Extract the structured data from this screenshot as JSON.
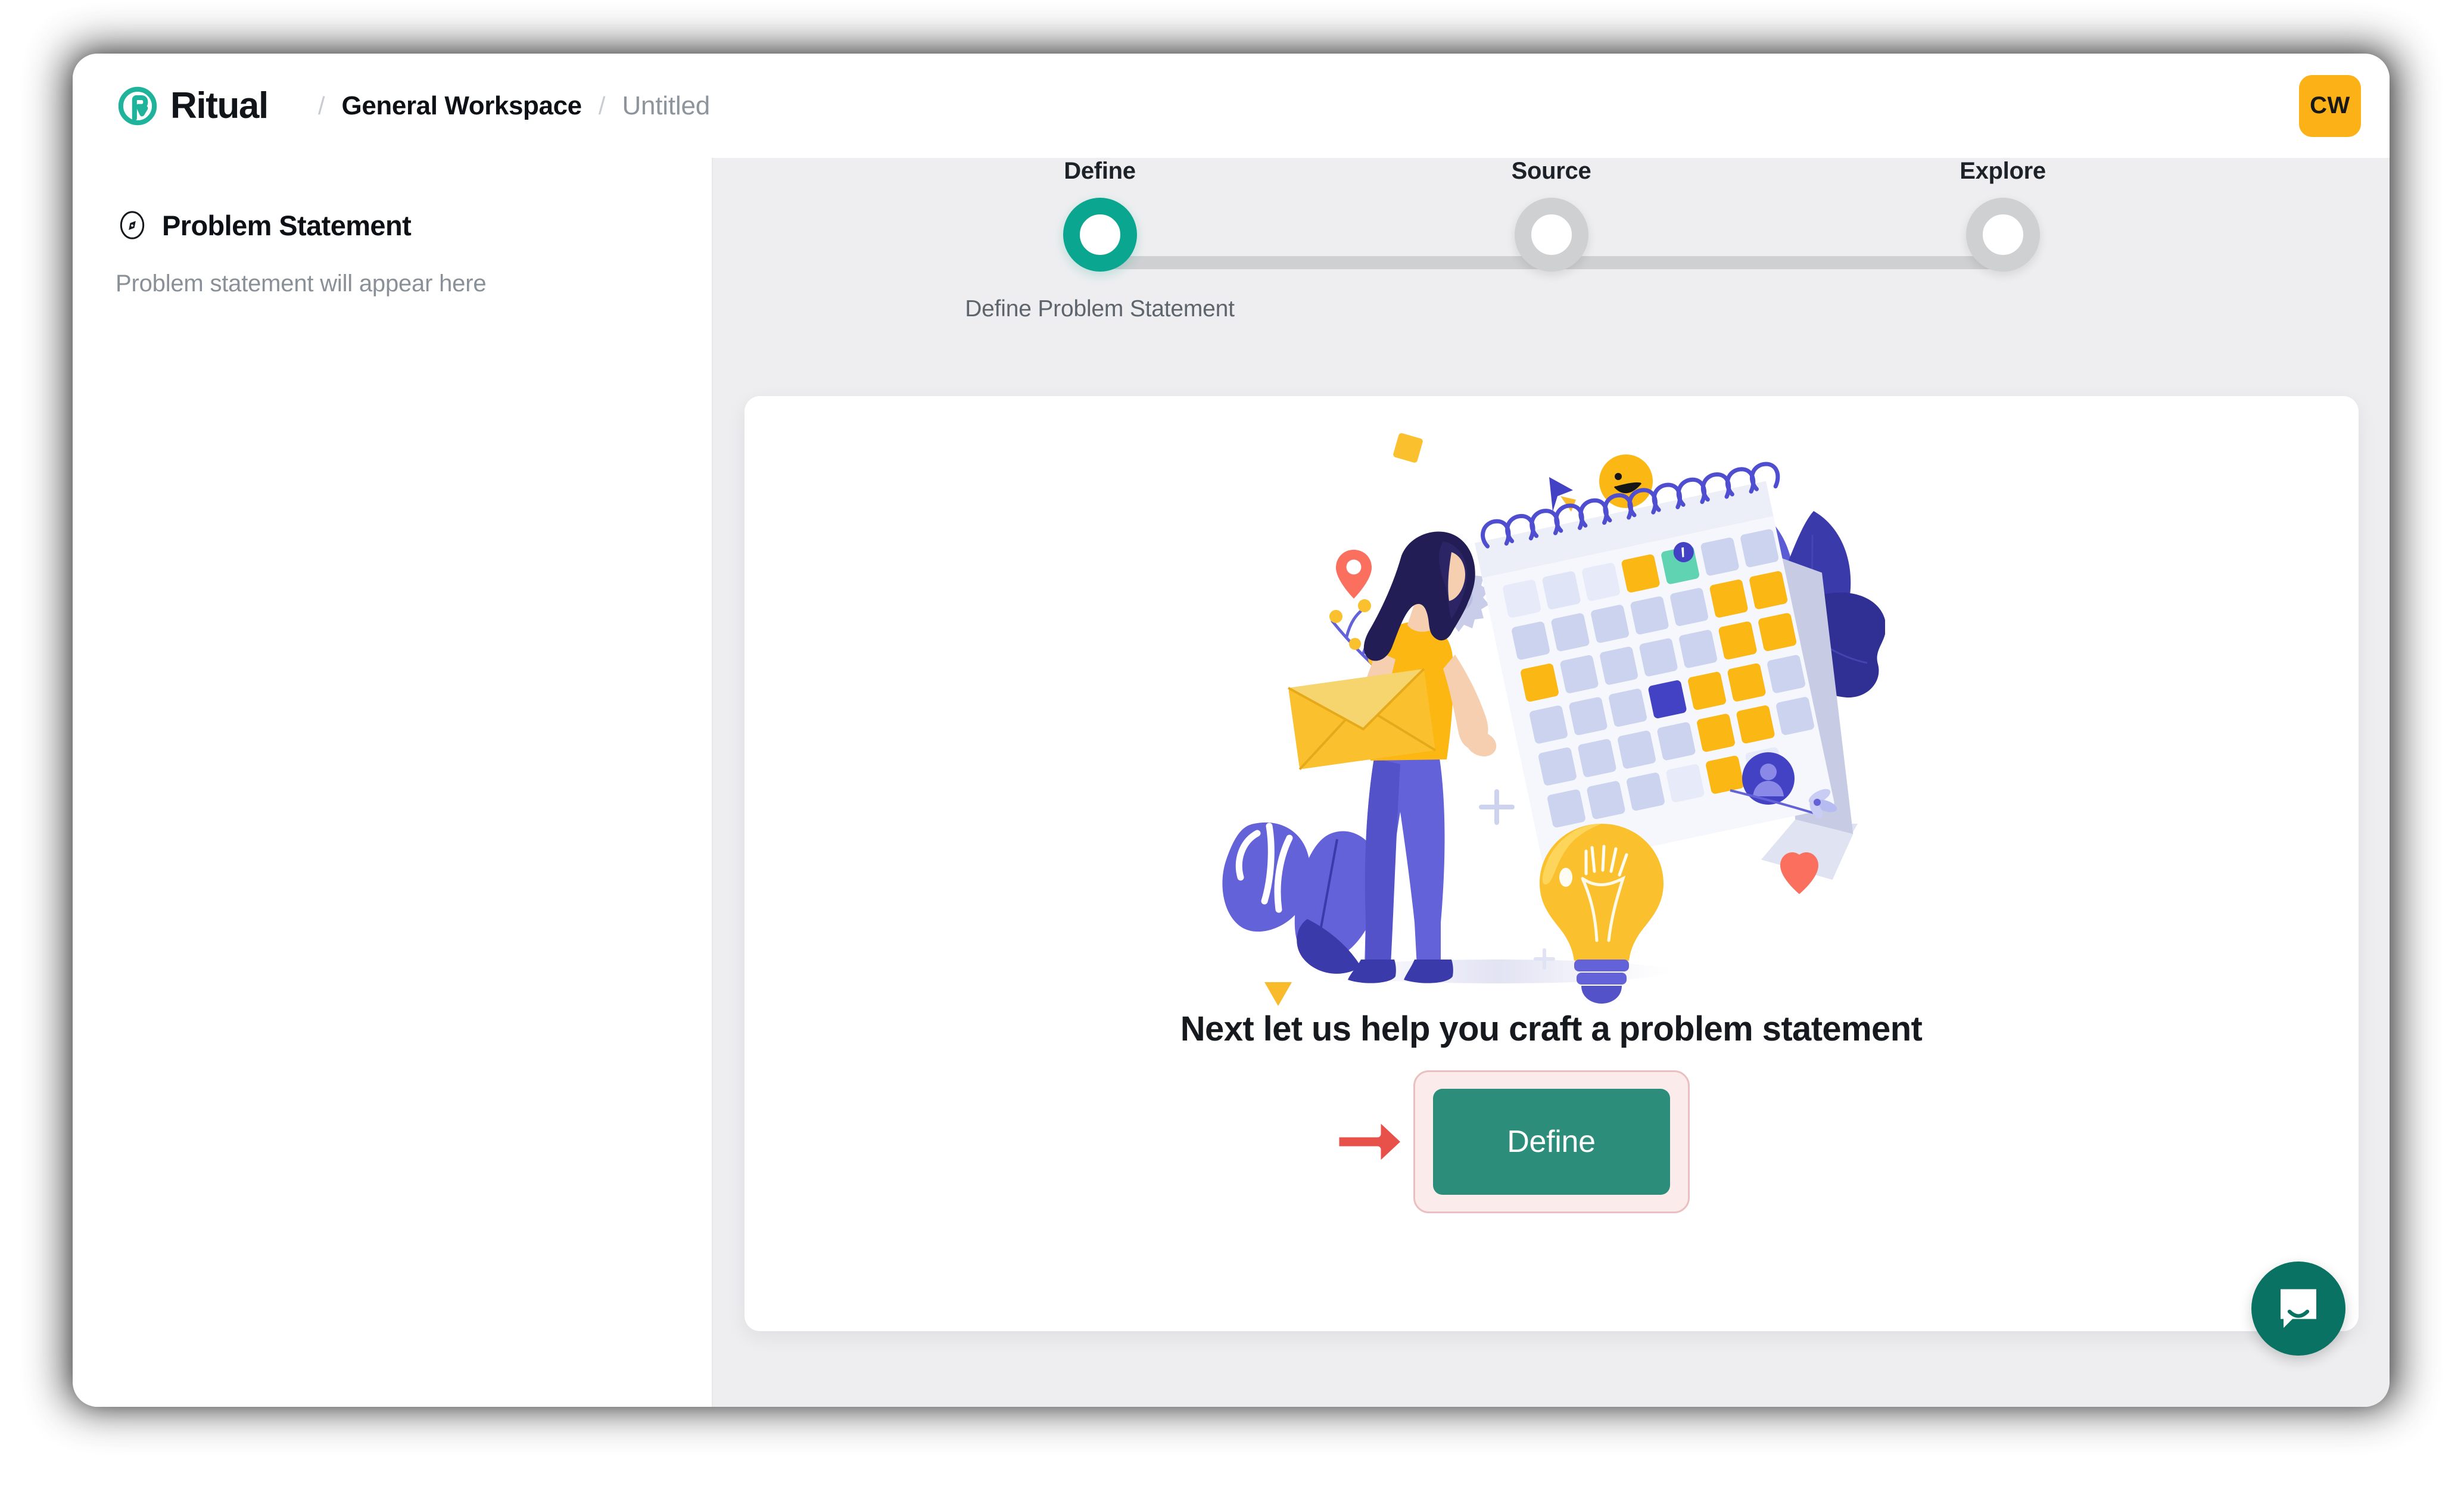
{
  "app": {
    "brand_name": "Ritual",
    "logo_icon": "ritual-logo-icon",
    "accent_teal": "#0aa68f",
    "button_teal": "#2d8d7b",
    "avatar_bg": "#fcb117"
  },
  "topbar": {
    "breadcrumb": {
      "separator": "/",
      "workspace": "General Workspace",
      "document": "Untitled"
    },
    "avatar_initials": "CW"
  },
  "sidebar": {
    "icon": "compass-icon",
    "title": "Problem Statement",
    "placeholder": "Problem statement will appear here"
  },
  "stepper": {
    "steps": [
      {
        "label": "Define",
        "state": "active"
      },
      {
        "label": "Source",
        "state": "pending"
      },
      {
        "label": "Explore",
        "state": "pending"
      }
    ],
    "active_caption": "Define Problem Statement"
  },
  "card": {
    "illustration": "woman-with-calendar-illustration",
    "headline": "Next let us help you craft a problem statement",
    "cta_label": "Define",
    "annotation": {
      "arrow_icon": "right-arrow-annotation-icon",
      "arrow_color": "#e8504a",
      "highlight_bg": "#fbeceb",
      "highlight_border": "#eabfbf"
    }
  },
  "launcher": {
    "icon": "intercom-chat-icon",
    "color": "#0a7263"
  }
}
